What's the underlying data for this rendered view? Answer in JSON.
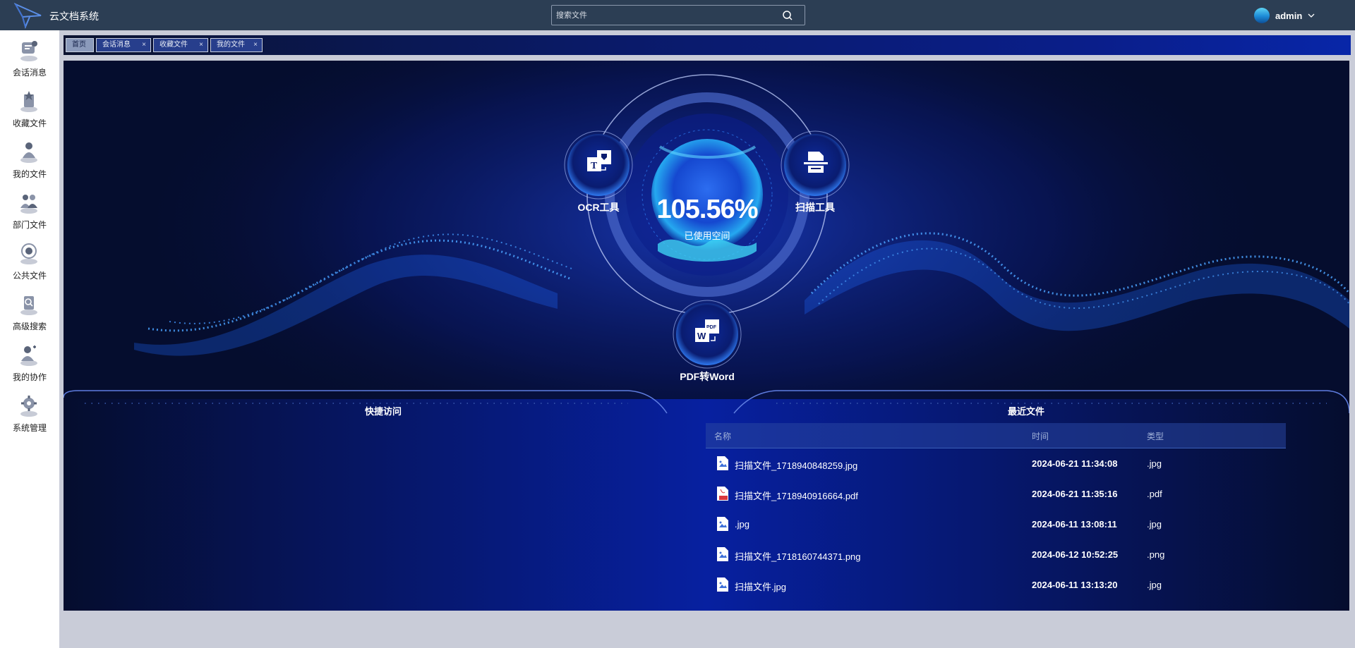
{
  "header": {
    "app_title": "云文档系统",
    "search_placeholder": "搜索文件",
    "user_name": "admin"
  },
  "sidebar": {
    "items": [
      {
        "label": "会话消息",
        "icon": "chat-icon"
      },
      {
        "label": "收藏文件",
        "icon": "favorite-icon"
      },
      {
        "label": "我的文件",
        "icon": "my-files-icon"
      },
      {
        "label": "部门文件",
        "icon": "department-icon"
      },
      {
        "label": "公共文件",
        "icon": "public-files-icon"
      },
      {
        "label": "高级搜索",
        "icon": "advanced-search-icon"
      },
      {
        "label": "我的协作",
        "icon": "collaboration-icon"
      },
      {
        "label": "系统管理",
        "icon": "settings-icon"
      }
    ]
  },
  "tabs": [
    {
      "label": "首页",
      "active": true
    },
    {
      "label": "会话消息",
      "close": "×"
    },
    {
      "label": "收藏文件",
      "close": "×"
    },
    {
      "label": "我的文件",
      "close": "×"
    }
  ],
  "dashboard": {
    "usage_value": "105.56%",
    "usage_label": "已使用空间",
    "tools": {
      "ocr": "OCR工具",
      "scan": "扫描工具",
      "pdf_word": "PDF转Word"
    },
    "quick_access_title": "快捷访问",
    "recent_title": "最近文件"
  },
  "recent_files": {
    "columns": [
      "名称",
      "时间",
      "类型"
    ],
    "rows": [
      {
        "name": "扫描文件_1718940848259.jpg",
        "time": "2024-06-21 11:34:08",
        "type": ".jpg",
        "icon": "image-file-icon"
      },
      {
        "name": "扫描文件_1718940916664.pdf",
        "time": "2024-06-21 11:35:16",
        "type": ".pdf",
        "icon": "pdf-file-icon"
      },
      {
        "name": ".jpg",
        "time": "2024-06-11 13:08:11",
        "type": ".jpg",
        "icon": "image-file-icon"
      },
      {
        "name": "扫描文件_1718160744371.png",
        "time": "2024-06-12 10:52:25",
        "type": ".png",
        "icon": "image-file-icon"
      },
      {
        "name": "扫描文件.jpg",
        "time": "2024-06-11 13:13:20",
        "type": ".jpg",
        "icon": "image-file-icon"
      }
    ]
  },
  "colors": {
    "header_bg": "#2c3e54",
    "dashboard_bg": "#050d2e",
    "accent_blue": "#1f6bff"
  }
}
